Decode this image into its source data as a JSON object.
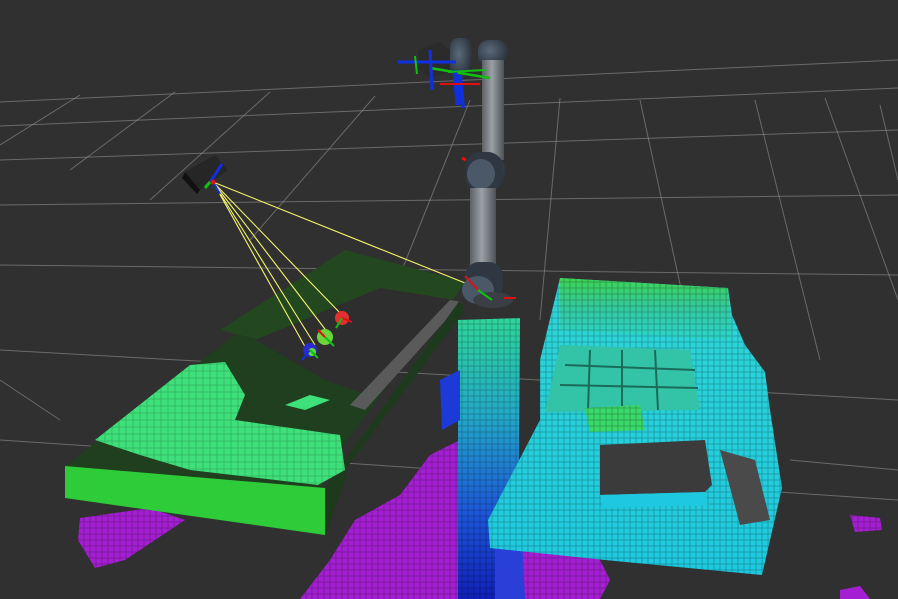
{
  "viewport": {
    "background_color": "#303030",
    "grid_color": "#9a9a9a"
  },
  "scene": {
    "robot_arm": {
      "link_color": "#888d93",
      "joint_color": "#3c4651",
      "joint_cap_color": "#2b3440"
    },
    "camera": {
      "body_color": "#262626",
      "ray_color": "#f5f56b",
      "ray_count": 5
    },
    "axes": {
      "x_color": "#e01010",
      "y_color": "#10c010",
      "z_color": "#1030e0"
    },
    "markers": [
      {
        "name": "marker-red",
        "color": "#e23030"
      },
      {
        "name": "marker-green",
        "color": "#6ad53a"
      },
      {
        "name": "marker-blue",
        "color": "#2a2ad0"
      }
    ],
    "octomap_colors": {
      "floor_magenta": "#a51fd2",
      "deep_blue": "#1a2ad6",
      "cyan": "#25d7dd",
      "teal": "#33c8a6",
      "light_green": "#3ee08a",
      "green": "#39d557"
    },
    "table": {
      "top_color": "#204a1f",
      "edge_color": "#2fcc3a"
    }
  }
}
